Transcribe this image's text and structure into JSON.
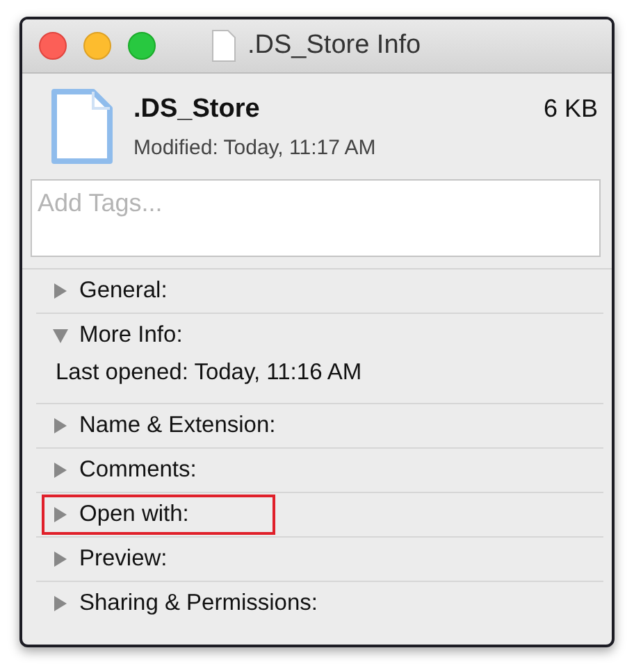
{
  "window": {
    "title": ".DS_Store Info"
  },
  "file": {
    "name": ".DS_Store",
    "size": "6 KB",
    "modified": "Modified: Today, 11:17 AM"
  },
  "tags": {
    "placeholder": "Add Tags..."
  },
  "sections": [
    {
      "label": "General:",
      "expanded": false,
      "highlighted": false
    },
    {
      "label": "More Info:",
      "expanded": true,
      "highlighted": false,
      "content": [
        "Last opened: Today, 11:16 AM"
      ]
    },
    {
      "label": "Name & Extension:",
      "expanded": false,
      "highlighted": false
    },
    {
      "label": "Comments:",
      "expanded": false,
      "highlighted": false
    },
    {
      "label": "Open with:",
      "expanded": false,
      "highlighted": true
    },
    {
      "label": "Preview:",
      "expanded": false,
      "highlighted": false
    },
    {
      "label": "Sharing & Permissions:",
      "expanded": false,
      "highlighted": false
    }
  ]
}
